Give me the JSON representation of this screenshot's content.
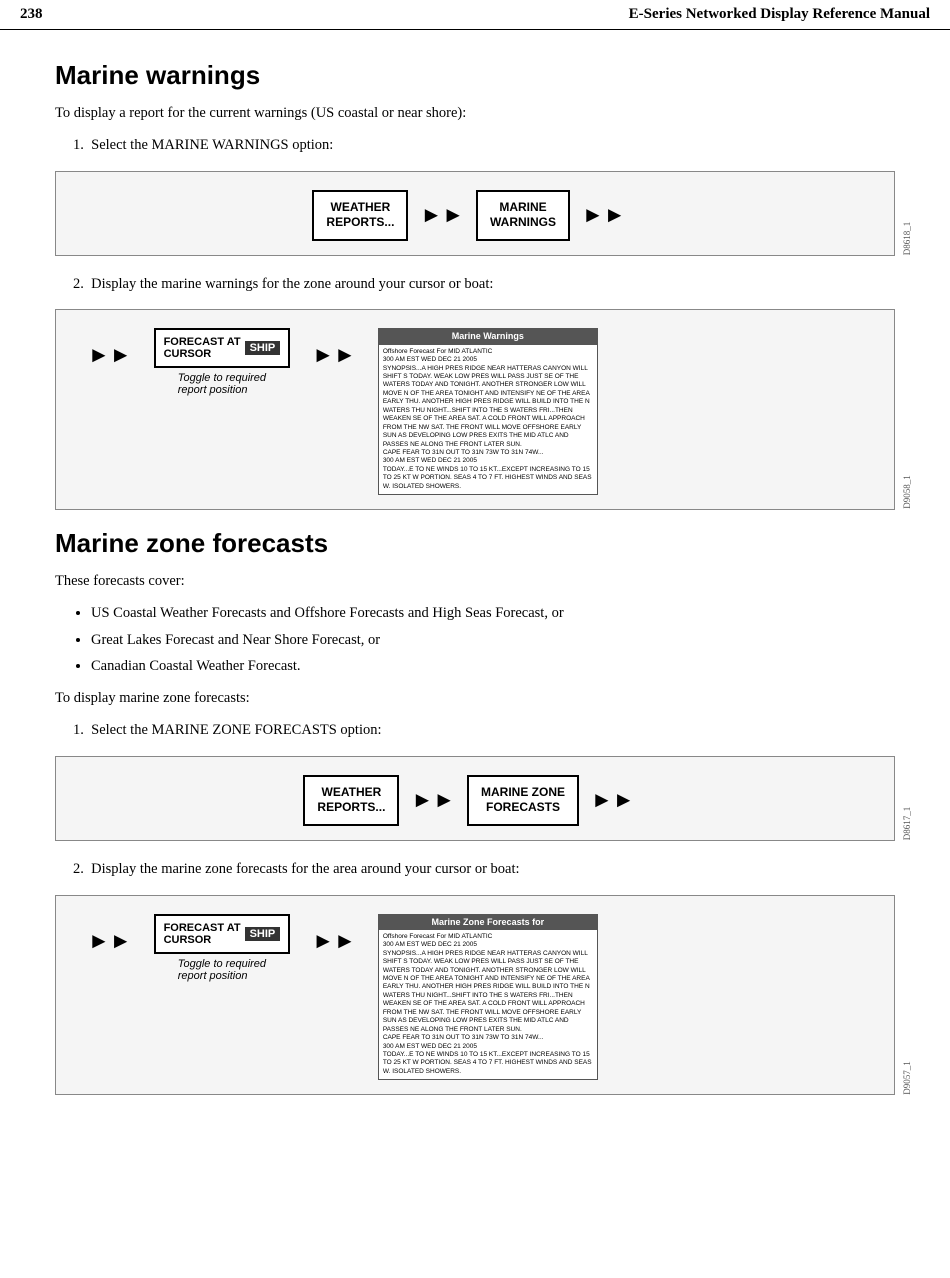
{
  "header": {
    "page_number": "238",
    "title": "E-Series Networked Display Reference Manual"
  },
  "section1": {
    "heading": "Marine warnings",
    "intro": "To display a report for the current warnings (US coastal or near shore):",
    "step1_label": "1.",
    "step1_text": "Select the MARINE WARNINGS option:",
    "step2_label": "2.",
    "step2_text": "Display the marine warnings for the zone around your cursor or boat:",
    "diagram1": {
      "button1": "WEATHER\nREPORTS...",
      "button2": "MARINE\nWARNINGS",
      "diagram_id": "D8618_1"
    },
    "diagram2": {
      "forecast_line1": "FORECAST AT",
      "forecast_line2": "CURSOR",
      "ship_label": "SHIP",
      "toggle_text": "Toggle to required\nreport position",
      "panel_title": "Marine Warnings",
      "panel_body": "Offshore Forecast For MID ATLANTIC\n300 AM EST WED DEC 21 2005\nSYNOPSIS...A HIGH PRES RIDGE NEAR HATTERAS CANYON WILL SHIFT S TODAY. WEAK LOW PRES WILL PASS JUST SE OF THE WATERS TODAY AND TONIGHT. ANOTHER STRONGER LOW WILL MOVE N OF THE AREA TONIGHT AND INTENSIFY NE OF THE AREA EARLY THU. ANOTHER HIGH PRES RIDGE WILL BUILD INTO THE N WATERS THU NIGHT...SHIFT INTO THE S WATERS FRI...THEN WEAKEN SE OF THE AREA SAT. A COLD FRONT WILL APPROACH FROM THE NW SAT. THE FRONT WILL MOVE OFFSHORE EARLY SUN AS DEVELOPING LOW PRES EXITS THE MID ATLC AND PASSES NE ALONG THE FRONT LATER SUN.\nCAPE FEAR TO 31N OUT TO 31N 73W TO 31N 74W...\n300 AM EST WED DEC 21 2005\nTODAY...E TO NE WINDS 10 TO 15 KT...EXCEPT INCREASING TO 15 TO 25 KT W PORTION. SEAS 4 TO 7 FT. HIGHEST WINDS AND SEAS W. ISOLATED SHOWERS.",
      "diagram_id": "D9058_1"
    }
  },
  "section2": {
    "heading": "Marine zone forecasts",
    "intro": "These forecasts cover:",
    "bullets": [
      "US Coastal Weather Forecasts and Offshore Forecasts and High Seas Forecast, or",
      "Great Lakes Forecast and Near Shore Forecast, or",
      "Canadian Coastal Weather Forecast."
    ],
    "step_intro": "To display marine zone forecasts:",
    "step1_label": "1.",
    "step1_text": "Select the MARINE ZONE FORECASTS option:",
    "step2_label": "2.",
    "step2_text": "Display the marine zone forecasts for the area around your cursor or boat:",
    "diagram3": {
      "button1": "WEATHER\nREPORTS...",
      "button2": "MARINE ZONE\nFORECASTS",
      "diagram_id": "D8617_1"
    },
    "diagram4": {
      "forecast_line1": "FORECAST AT",
      "forecast_line2": "CURSOR",
      "ship_label": "SHIP",
      "toggle_text": "Toggle to required\nreport position",
      "panel_title": "Marine Zone Forecasts for",
      "panel_body": "Offshore Forecast For MID ATLANTIC\n300 AM EST WED DEC 21 2005\nSYNOPSIS...A HIGH PRES RIDGE NEAR HATTERAS CANYON WILL SHIFT S TODAY. WEAK LOW PRES WILL PASS JUST SE OF THE WATERS TODAY AND TONIGHT. ANOTHER STRONGER LOW WILL MOVE N OF THE AREA TONIGHT AND INTENSIFY NE OF THE AREA EARLY THU. ANOTHER HIGH PRES RIDGE WILL BUILD INTO THE N WATERS THU NIGHT...SHIFT INTO THE S WATERS FRI...THEN WEAKEN SE OF THE AREA SAT. A COLD FRONT WILL APPROACH FROM THE NW SAT. THE FRONT WILL MOVE OFFSHORE EARLY SUN AS DEVELOPING LOW PRES EXITS THE MID ATLC AND PASSES NE ALONG THE FRONT LATER SUN.\nCAPE FEAR TO 31N OUT TO 31N 73W TO 31N 74W...\n300 AM EST WED DEC 21 2005\nTODAY...E TO NE WINDS 10 TO 15 KT...EXCEPT INCREASING TO 15 TO 25 KT W PORTION. SEAS 4 TO 7 FT. HIGHEST WINDS AND SEAS W. ISOLATED SHOWERS.",
      "diagram_id": "D9057_1"
    }
  }
}
